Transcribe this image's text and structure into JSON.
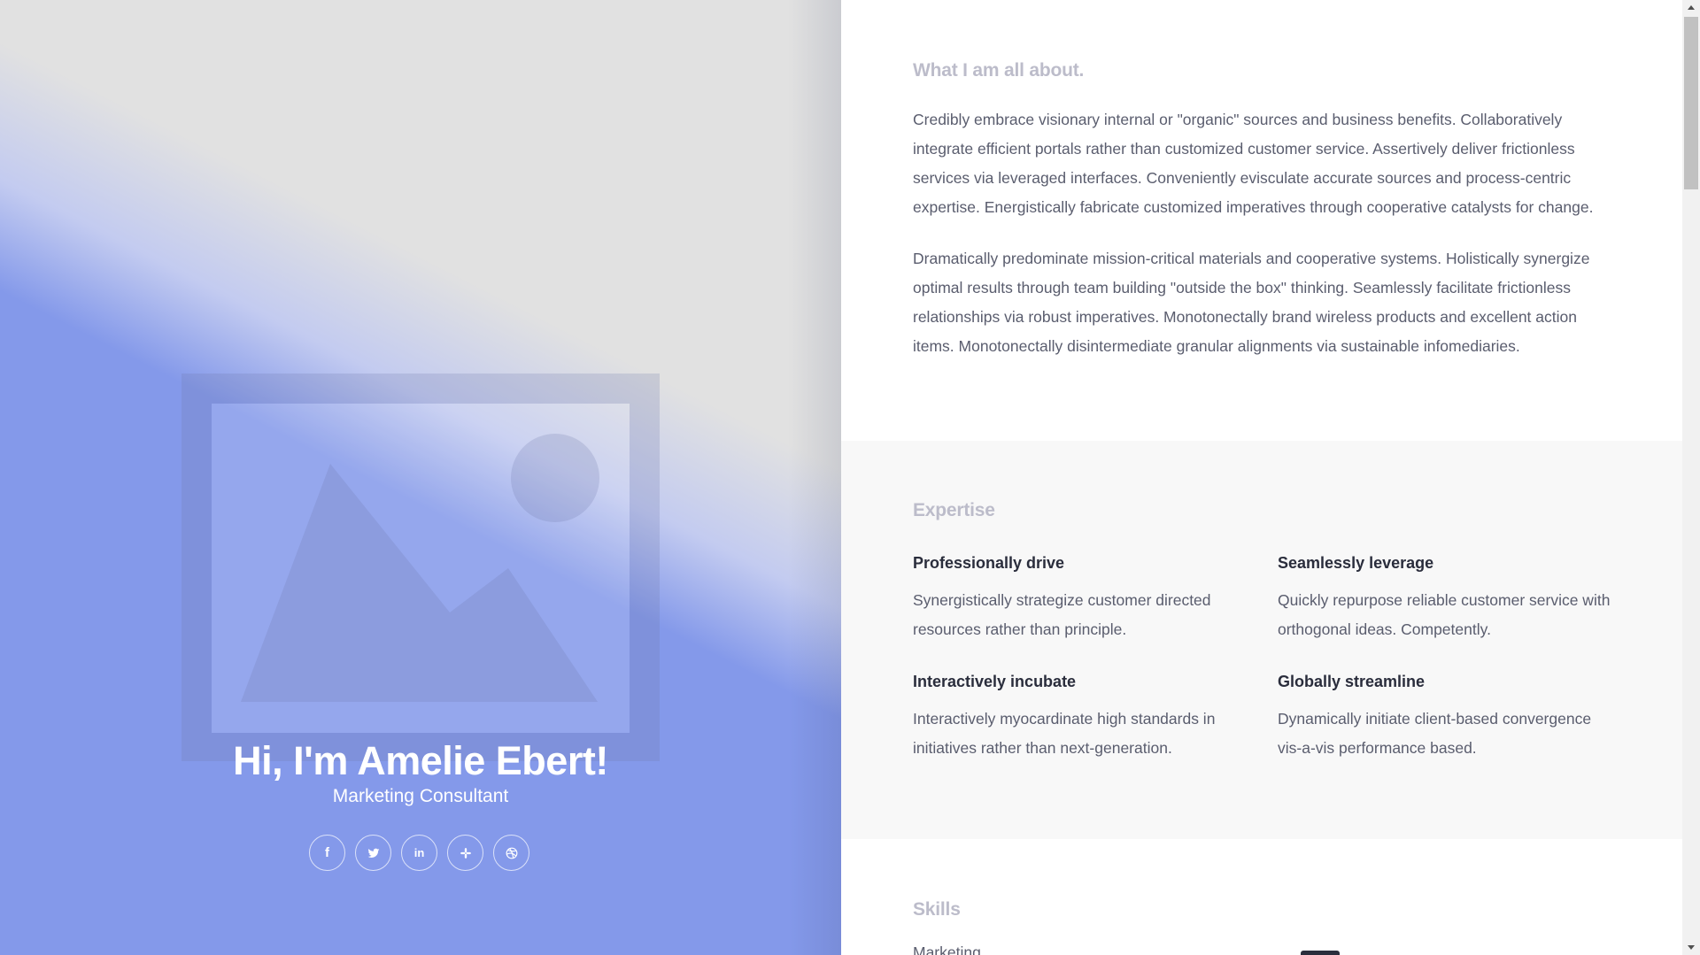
{
  "hero": {
    "name": "Hi, I'm Amelie Ebert!",
    "role": "Marketing Consultant",
    "photo_icon": "image-placeholder-icon",
    "social": [
      {
        "name": "facebook",
        "icon": "facebook-icon",
        "glyph": "f"
      },
      {
        "name": "twitter",
        "icon": "twitter-icon",
        "glyph": ""
      },
      {
        "name": "linkedin",
        "icon": "linkedin-icon",
        "glyph": "in"
      },
      {
        "name": "slack",
        "icon": "slack-icon",
        "glyph": ""
      },
      {
        "name": "dribbble",
        "icon": "dribbble-icon",
        "glyph": ""
      }
    ]
  },
  "about": {
    "title": "What I am all about.",
    "paragraphs": [
      "Credibly embrace visionary internal or \"organic\" sources and business benefits. Collaboratively integrate efficient portals rather than customized customer service. Assertively deliver frictionless services via leveraged interfaces. Conveniently evisculate accurate sources and process-centric expertise. Energistically fabricate customized imperatives through cooperative catalysts for change.",
      "Dramatically predominate mission-critical materials and cooperative systems. Holistically synergize optimal results through team building \"outside the box\" thinking. Seamlessly facilitate frictionless relationships via robust imperatives. Monotonectally brand wireless products and excellent action items. Monotonectally disintermediate granular alignments via sustainable infomediaries."
    ]
  },
  "expertise": {
    "title": "Expertise",
    "items": [
      {
        "heading": "Professionally drive",
        "text": "Synergistically strategize customer directed resources rather than principle."
      },
      {
        "heading": "Seamlessly leverage",
        "text": "Quickly repurpose reliable customer service with orthogonal ideas. Competently."
      },
      {
        "heading": "Interactively incubate",
        "text": "Interactively myocardinate high standards in initiatives rather than next-generation."
      },
      {
        "heading": "Globally streamline",
        "text": "Dynamically initiate client-based convergence vis-a-vis performance based."
      }
    ]
  },
  "skills": {
    "title": "Skills",
    "first_skill": "Marketing"
  },
  "colors": {
    "hero_blue": "#8499ea",
    "hero_grey": "#e1e1e1",
    "title_grey": "#bcbcca",
    "text": "#5a5d6e",
    "heading": "#2a2d3c",
    "section_alt_bg": "#f8f8f8"
  }
}
